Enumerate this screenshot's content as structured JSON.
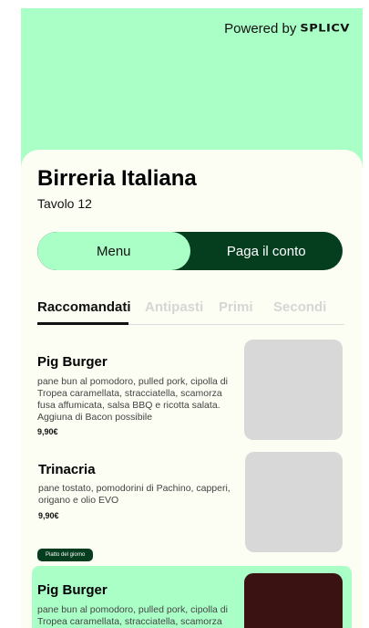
{
  "powered": {
    "prefix": "Powered by",
    "brand": "SPLICV"
  },
  "restaurant": {
    "name": "Birreria Italiana",
    "table": "Tavolo 12"
  },
  "toggle": {
    "menu_label": "Menu",
    "pay_label": "Paga il conto"
  },
  "tabs": [
    "Raccomandati",
    "Antipasti",
    "Primi",
    "Secondi"
  ],
  "items": [
    {
      "name": "Pig Burger",
      "description": "pane bun al pomodoro, pulled pork, cipolla di Tropea caramellata, stracciatella, scamorza fusa affumicata, salsa BBQ e ricotta salata. Aggiuna di Bacon possibile",
      "price": "9,90€"
    },
    {
      "name": "Trinacria",
      "description": "pane tostato, pomodorini di Pachino, capperi, origano e olio EVO",
      "price": "9,90€"
    },
    {
      "badge": "Piatto del giorno",
      "name": "Pig Burger",
      "description": "pane bun al pomodoro, pulled pork, cipolla di Tropea caramellata, stracciatella, scamorza fusa affumicata, salsa BBQ e ricotta salata.",
      "price": ""
    }
  ],
  "colors": {
    "accent_green": "#aaffc7",
    "dark_green": "#053d1f",
    "placeholder": "#d8d8d8",
    "featured_image": "#3a1212"
  }
}
